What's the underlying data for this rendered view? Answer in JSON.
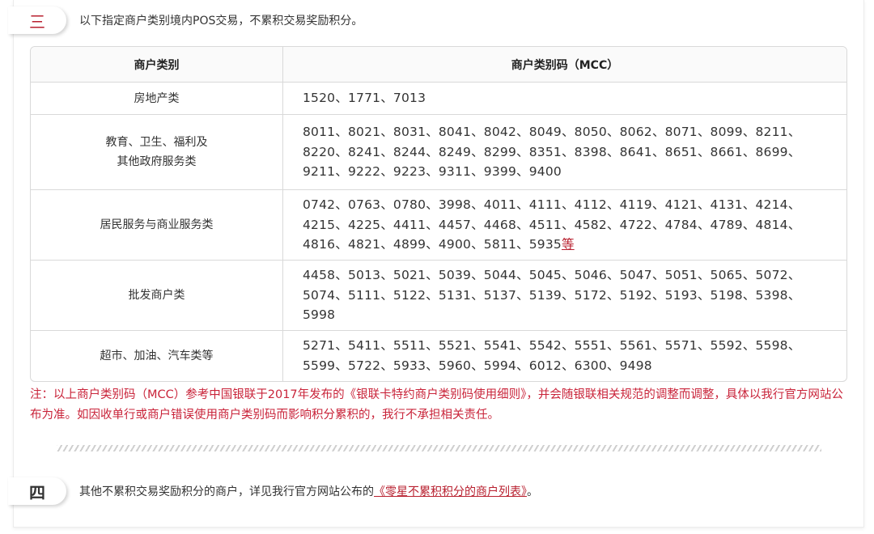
{
  "section3": {
    "badge": "三",
    "text": "以下指定商户类别境内POS交易，不累积交易奖励积分。"
  },
  "table": {
    "headers": [
      "商户类别",
      "商户类别码（MCC）"
    ],
    "rows": [
      {
        "category": "房地产类",
        "codes": "1520、1771、7013"
      },
      {
        "category_line1": "教育、卫生、福利及",
        "category_line2": "其他政府服务类",
        "codes": "8011、8021、8031、8041、8042、8049、8050、8062、8071、8099、8211、8220、8241、8244、8249、8299、8351、8398、8641、8651、8661、8699、9211、9222、9223、9311、9399、9400"
      },
      {
        "category": "居民服务与商业服务类",
        "codes": "0742、0763、0780、3998、4011、4111、4112、4119、4121、4131、4214、4215、4225、4411、4457、4468、4511、4582、4722、4784、4789、4814、4816、4821、4899、4900、5811、5935",
        "codes_suffix": "等"
      },
      {
        "category": "批发商户类",
        "codes": "4458、5013、5021、5039、5044、5045、5046、5047、5051、5065、5072、5074、5111、5122、5131、5137、5139、5172、5192、5193、5198、5398、5998"
      },
      {
        "category": "超市、加油、汽车类等",
        "codes": "5271、5411、5511、5521、5541、5542、5551、5561、5571、5592、5598、5599、5722、5933、5960、5994、6012、6300、9498"
      }
    ]
  },
  "note": "注：以上商户类别码（MCC）参考中国银联于2017年发布的《银联卡特约商户类别码使用细则》，并会随银联相关规范的调整而调整，具体以我行官方网站公布为准。如因收单行或商户错误使用商户类别码而影响积分累积的，我行不承担相关责任。",
  "section4": {
    "badge": "四",
    "text_before": "其他不累积交易奖励积分的商户，详见我行官方网站公布的",
    "link": "《零星不累积积分的商户列表》",
    "text_after": "。"
  },
  "colors": {
    "accent_red": "#b8202f",
    "note_red": "#c9243a",
    "border": "#d9d9d9"
  }
}
